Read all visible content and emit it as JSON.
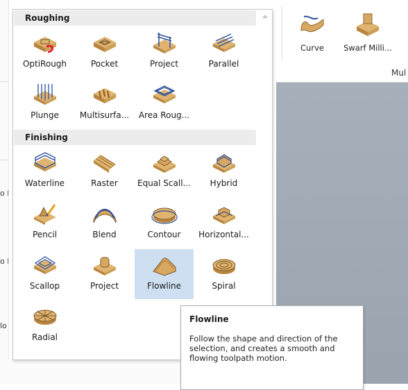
{
  "ribbon": {
    "items": [
      {
        "label": "Curve",
        "icon": "curve-machining-icon"
      },
      {
        "label": "Swarf Milli...",
        "icon": "swarf-milling-icon"
      }
    ],
    "group_label": "Mul"
  },
  "gallery": {
    "sections": [
      {
        "title": "Roughing",
        "items": [
          {
            "label": "OptiRough",
            "icon": "optirough-icon"
          },
          {
            "label": "Pocket",
            "icon": "pocket-icon"
          },
          {
            "label": "Project",
            "icon": "project-icon"
          },
          {
            "label": "Parallel",
            "icon": "parallel-icon"
          },
          {
            "label": "Plunge",
            "icon": "plunge-icon"
          },
          {
            "label": "Multisurfa...",
            "icon": "multisurface-icon"
          },
          {
            "label": "Area Roug...",
            "icon": "area-roughing-icon"
          }
        ]
      },
      {
        "title": "Finishing",
        "items": [
          {
            "label": "Waterline",
            "icon": "waterline-icon"
          },
          {
            "label": "Raster",
            "icon": "raster-icon"
          },
          {
            "label": "Equal Scall...",
            "icon": "equal-scallop-icon"
          },
          {
            "label": "Hybrid",
            "icon": "hybrid-icon"
          },
          {
            "label": "Pencil",
            "icon": "pencil-icon"
          },
          {
            "label": "Blend",
            "icon": "blend-icon"
          },
          {
            "label": "Contour",
            "icon": "contour-icon"
          },
          {
            "label": "Horizontal...",
            "icon": "horizontal-area-icon"
          },
          {
            "label": "Scallop",
            "icon": "scallop-icon"
          },
          {
            "label": "Project",
            "icon": "project-finish-icon"
          },
          {
            "label": "Flowline",
            "icon": "flowline-icon",
            "selected": true
          },
          {
            "label": "Spiral",
            "icon": "spiral-icon"
          },
          {
            "label": "Radial",
            "icon": "radial-icon"
          }
        ]
      }
    ]
  },
  "tooltip": {
    "title": "Flowline",
    "body": "Follow the shape and direction of the selection, and creates a smooth and flowing toolpath motion."
  },
  "colors": {
    "stock": "#d9a860",
    "stock_dark": "#b9853e",
    "toolpath": "#2a4e9a",
    "selected_tile": "#cfdff2",
    "section_header": "#ececec",
    "viewport": "#9ea8b2"
  }
}
